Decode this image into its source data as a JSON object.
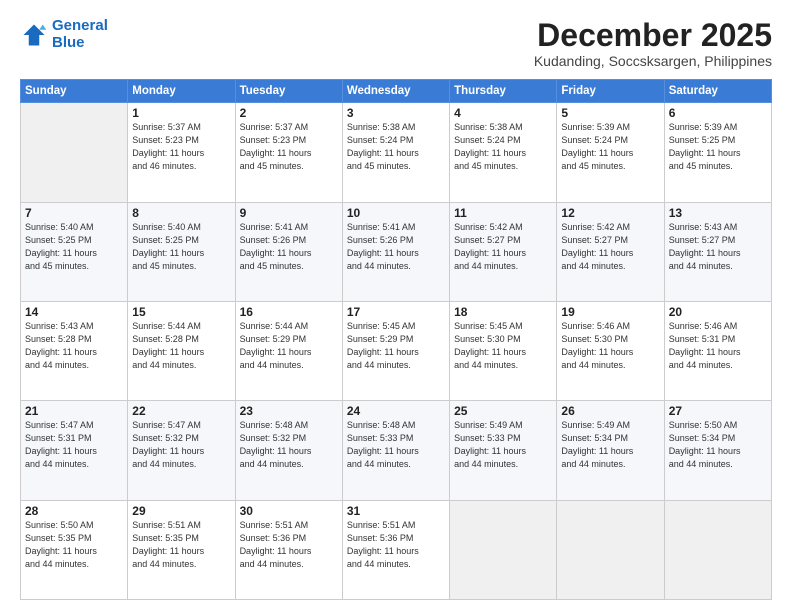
{
  "header": {
    "logo_line1": "General",
    "logo_line2": "Blue",
    "month": "December 2025",
    "location": "Kudanding, Soccsksargen, Philippines"
  },
  "weekdays": [
    "Sunday",
    "Monday",
    "Tuesday",
    "Wednesday",
    "Thursday",
    "Friday",
    "Saturday"
  ],
  "weeks": [
    [
      {
        "day": "",
        "info": ""
      },
      {
        "day": "1",
        "info": "Sunrise: 5:37 AM\nSunset: 5:23 PM\nDaylight: 11 hours\nand 46 minutes."
      },
      {
        "day": "2",
        "info": "Sunrise: 5:37 AM\nSunset: 5:23 PM\nDaylight: 11 hours\nand 45 minutes."
      },
      {
        "day": "3",
        "info": "Sunrise: 5:38 AM\nSunset: 5:24 PM\nDaylight: 11 hours\nand 45 minutes."
      },
      {
        "day": "4",
        "info": "Sunrise: 5:38 AM\nSunset: 5:24 PM\nDaylight: 11 hours\nand 45 minutes."
      },
      {
        "day": "5",
        "info": "Sunrise: 5:39 AM\nSunset: 5:24 PM\nDaylight: 11 hours\nand 45 minutes."
      },
      {
        "day": "6",
        "info": "Sunrise: 5:39 AM\nSunset: 5:25 PM\nDaylight: 11 hours\nand 45 minutes."
      }
    ],
    [
      {
        "day": "7",
        "info": "Sunrise: 5:40 AM\nSunset: 5:25 PM\nDaylight: 11 hours\nand 45 minutes."
      },
      {
        "day": "8",
        "info": "Sunrise: 5:40 AM\nSunset: 5:25 PM\nDaylight: 11 hours\nand 45 minutes."
      },
      {
        "day": "9",
        "info": "Sunrise: 5:41 AM\nSunset: 5:26 PM\nDaylight: 11 hours\nand 45 minutes."
      },
      {
        "day": "10",
        "info": "Sunrise: 5:41 AM\nSunset: 5:26 PM\nDaylight: 11 hours\nand 44 minutes."
      },
      {
        "day": "11",
        "info": "Sunrise: 5:42 AM\nSunset: 5:27 PM\nDaylight: 11 hours\nand 44 minutes."
      },
      {
        "day": "12",
        "info": "Sunrise: 5:42 AM\nSunset: 5:27 PM\nDaylight: 11 hours\nand 44 minutes."
      },
      {
        "day": "13",
        "info": "Sunrise: 5:43 AM\nSunset: 5:27 PM\nDaylight: 11 hours\nand 44 minutes."
      }
    ],
    [
      {
        "day": "14",
        "info": "Sunrise: 5:43 AM\nSunset: 5:28 PM\nDaylight: 11 hours\nand 44 minutes."
      },
      {
        "day": "15",
        "info": "Sunrise: 5:44 AM\nSunset: 5:28 PM\nDaylight: 11 hours\nand 44 minutes."
      },
      {
        "day": "16",
        "info": "Sunrise: 5:44 AM\nSunset: 5:29 PM\nDaylight: 11 hours\nand 44 minutes."
      },
      {
        "day": "17",
        "info": "Sunrise: 5:45 AM\nSunset: 5:29 PM\nDaylight: 11 hours\nand 44 minutes."
      },
      {
        "day": "18",
        "info": "Sunrise: 5:45 AM\nSunset: 5:30 PM\nDaylight: 11 hours\nand 44 minutes."
      },
      {
        "day": "19",
        "info": "Sunrise: 5:46 AM\nSunset: 5:30 PM\nDaylight: 11 hours\nand 44 minutes."
      },
      {
        "day": "20",
        "info": "Sunrise: 5:46 AM\nSunset: 5:31 PM\nDaylight: 11 hours\nand 44 minutes."
      }
    ],
    [
      {
        "day": "21",
        "info": "Sunrise: 5:47 AM\nSunset: 5:31 PM\nDaylight: 11 hours\nand 44 minutes."
      },
      {
        "day": "22",
        "info": "Sunrise: 5:47 AM\nSunset: 5:32 PM\nDaylight: 11 hours\nand 44 minutes."
      },
      {
        "day": "23",
        "info": "Sunrise: 5:48 AM\nSunset: 5:32 PM\nDaylight: 11 hours\nand 44 minutes."
      },
      {
        "day": "24",
        "info": "Sunrise: 5:48 AM\nSunset: 5:33 PM\nDaylight: 11 hours\nand 44 minutes."
      },
      {
        "day": "25",
        "info": "Sunrise: 5:49 AM\nSunset: 5:33 PM\nDaylight: 11 hours\nand 44 minutes."
      },
      {
        "day": "26",
        "info": "Sunrise: 5:49 AM\nSunset: 5:34 PM\nDaylight: 11 hours\nand 44 minutes."
      },
      {
        "day": "27",
        "info": "Sunrise: 5:50 AM\nSunset: 5:34 PM\nDaylight: 11 hours\nand 44 minutes."
      }
    ],
    [
      {
        "day": "28",
        "info": "Sunrise: 5:50 AM\nSunset: 5:35 PM\nDaylight: 11 hours\nand 44 minutes."
      },
      {
        "day": "29",
        "info": "Sunrise: 5:51 AM\nSunset: 5:35 PM\nDaylight: 11 hours\nand 44 minutes."
      },
      {
        "day": "30",
        "info": "Sunrise: 5:51 AM\nSunset: 5:36 PM\nDaylight: 11 hours\nand 44 minutes."
      },
      {
        "day": "31",
        "info": "Sunrise: 5:51 AM\nSunset: 5:36 PM\nDaylight: 11 hours\nand 44 minutes."
      },
      {
        "day": "",
        "info": ""
      },
      {
        "day": "",
        "info": ""
      },
      {
        "day": "",
        "info": ""
      }
    ]
  ]
}
